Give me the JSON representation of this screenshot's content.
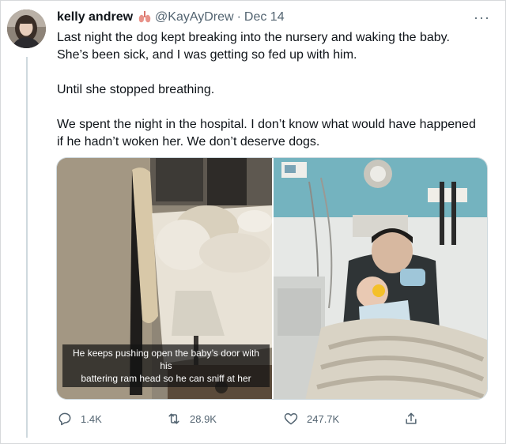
{
  "tweet": {
    "display_name": "kelly andrew",
    "emoji_badge": "lungs-emoji-icon",
    "handle": "@KayAyDrew",
    "separator": "·",
    "date": "Dec 14",
    "more_label": "···",
    "paragraphs": [
      [
        "Last night the dog kept breaking into the nursery and waking the baby.",
        "She’s been sick, and I was getting so fed up with him."
      ],
      [
        "Until she stopped breathing."
      ],
      [
        "We spent the night in the hospital. I don’t know what would have happened",
        "if he hadn’t woken her. We don’t deserve dogs."
      ]
    ]
  },
  "media": {
    "left_photo": {
      "subject": "bedroom with headboard, pillows and lamp",
      "caption_lines": [
        "He keeps pushing open the baby’s door with his",
        "battering ram head so he can sniff at her"
      ]
    },
    "right_photo": {
      "subject": "man holding baby in hospital room"
    }
  },
  "actions": {
    "reply_count": "1.4K",
    "retweet_count": "28.9K",
    "like_count": "247.7K"
  },
  "colors": {
    "text_primary": "#0f1419",
    "text_secondary": "#536471",
    "border": "#cfd9de"
  }
}
